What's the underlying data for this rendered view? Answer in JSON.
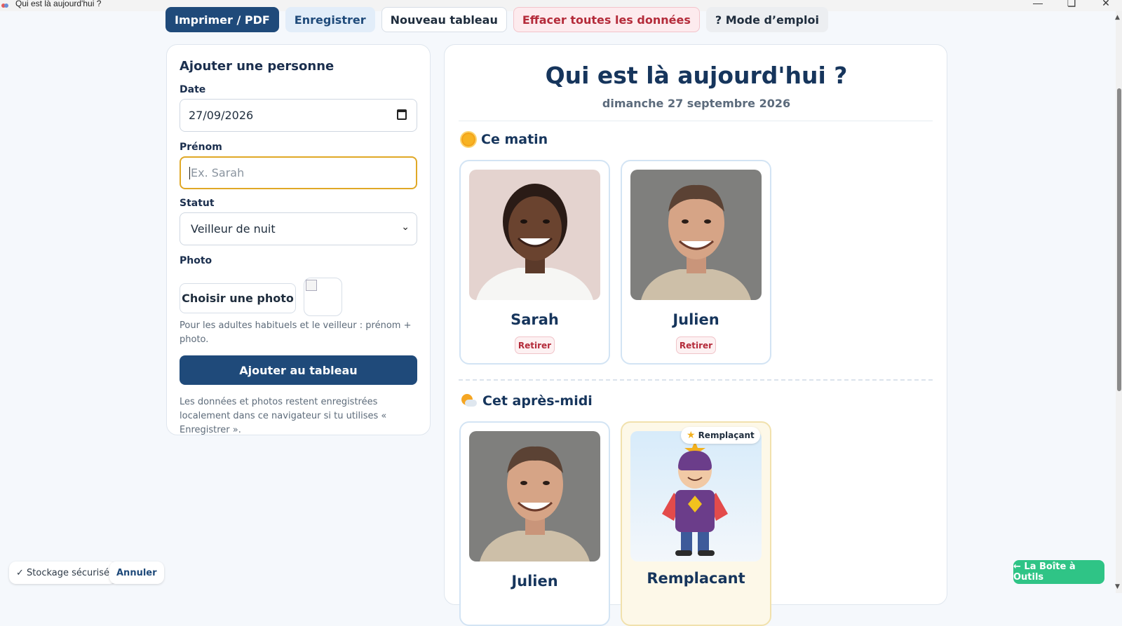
{
  "window": {
    "title": "Qui est là aujourd'hui ?"
  },
  "toolbar": {
    "print": "Imprimer / PDF",
    "save": "Enregistrer",
    "new_board": "Nouveau tableau",
    "clear_all": "Effacer toutes les données",
    "help": "? Mode d’emploi"
  },
  "form": {
    "title": "Ajouter une personne",
    "date_label": "Date",
    "date_value": "27/09/2026",
    "firstname_label": "Prénom",
    "firstname_placeholder": "Ex. Sarah",
    "status_label": "Statut",
    "status_value": "Veilleur de nuit",
    "photo_label": "Photo",
    "photo_button": "Choisir une photo",
    "photo_hint": "Pour les adultes habituels et le veilleur : prénom + photo.",
    "submit": "Ajouter au tableau",
    "storage_note": "Les données et photos restent enregistrées localement dans ce navigateur si tu utilises « Enregistrer »."
  },
  "board": {
    "title": "Qui est là aujourd'hui ?",
    "date": "dimanche 27 septembre 2026",
    "morning": {
      "label": "Ce matin",
      "people": [
        {
          "name": "Sarah",
          "remove": "Retirer"
        },
        {
          "name": "Julien",
          "remove": "Retirer"
        }
      ]
    },
    "afternoon": {
      "label": "Cet après-midi",
      "people": [
        {
          "name": "Julien"
        },
        {
          "name": "Remplacant",
          "badge": "Remplaçant"
        }
      ]
    }
  },
  "footer": {
    "secure": "✓ Stockage sécurisé",
    "cancel": "Annuler",
    "toolbox": "← La Boîte à Outils"
  },
  "colors": {
    "primary": "#1f4a7a",
    "accent_focus": "#e0a826",
    "danger": "#b42b3a",
    "toolbox_green": "#2fc486"
  }
}
